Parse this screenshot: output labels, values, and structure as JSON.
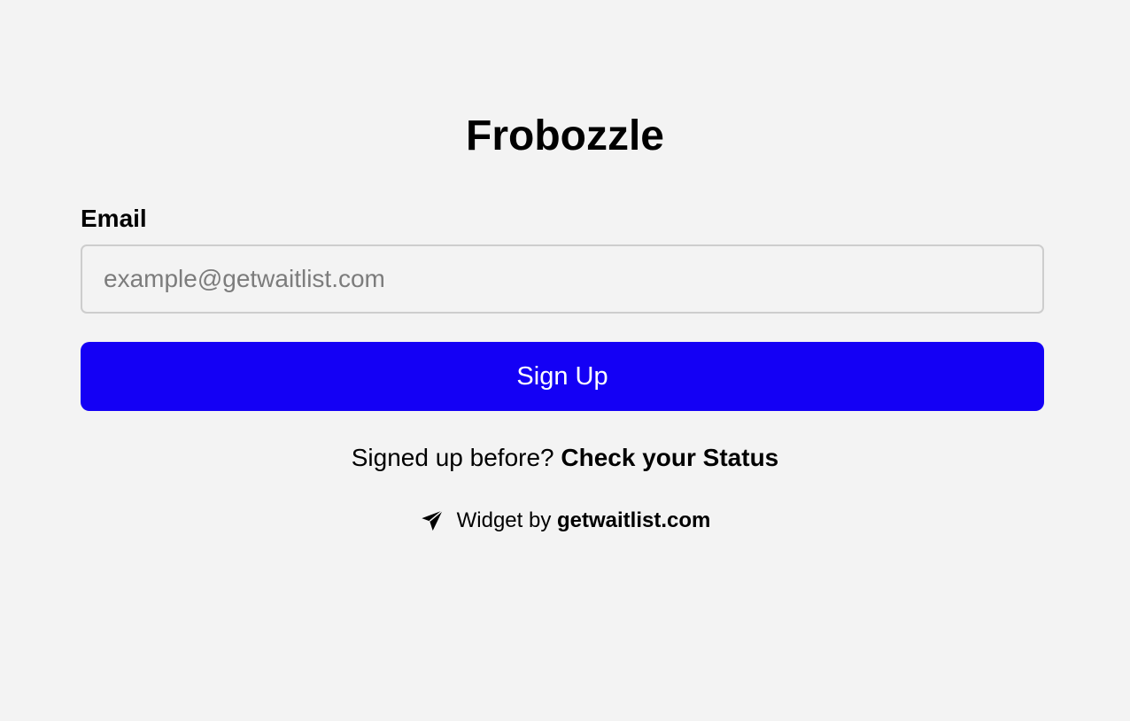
{
  "form": {
    "title": "Frobozzle",
    "email_label": "Email",
    "email_placeholder": "example@getwaitlist.com",
    "email_value": "",
    "submit_label": "Sign Up"
  },
  "status": {
    "prompt": "Signed up before?",
    "link_label": "Check your Status"
  },
  "footer": {
    "icon": "paper-plane-icon",
    "prefix": "Widget by",
    "link_label": "getwaitlist.com"
  },
  "colors": {
    "background": "#f3f3f3",
    "accent": "#1400f5",
    "input_border": "#cdcdcd",
    "placeholder": "#7c7c7c"
  }
}
